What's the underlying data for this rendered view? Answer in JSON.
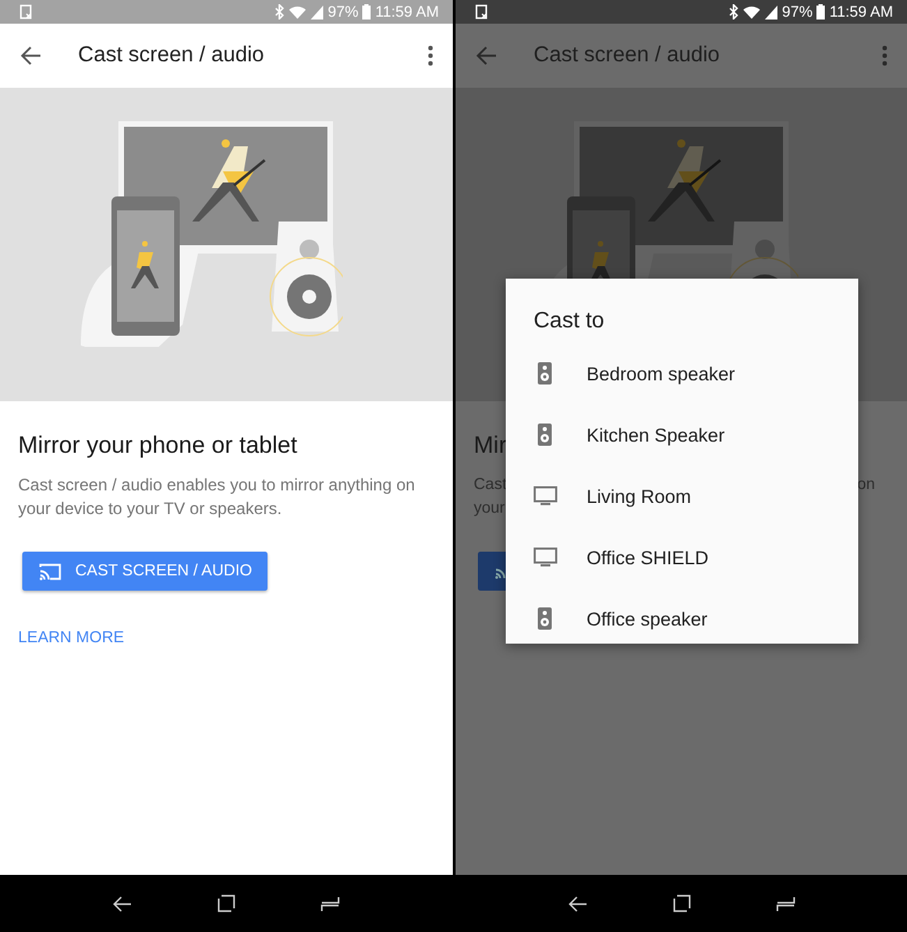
{
  "screens": [
    {
      "status_bar": {
        "battery": "97%",
        "time": "11:59 AM"
      },
      "app_bar": {
        "title": "Cast screen / audio"
      },
      "content": {
        "heading": "Mirror your phone or tablet",
        "description": "Cast screen / audio enables you to mirror anything on your device to your TV or speakers.",
        "button": "CAST SCREEN / AUDIO",
        "link": "LEARN MORE"
      }
    },
    {
      "status_bar": {
        "battery": "97%",
        "time": "11:59 AM"
      },
      "app_bar": {
        "title": "Cast screen / audio"
      },
      "covered_content": {
        "heading": "Mir",
        "line_1_start": "Cast",
        "line_1_end": "on",
        "line_2": "your"
      },
      "dialog": {
        "title": "Cast to",
        "devices": [
          {
            "name": "Bedroom speaker",
            "kind": "speaker"
          },
          {
            "name": "Kitchen Speaker",
            "kind": "speaker"
          },
          {
            "name": "Living Room",
            "kind": "tv"
          },
          {
            "name": "Office SHIELD",
            "kind": "tv"
          },
          {
            "name": "Office speaker",
            "kind": "speaker"
          }
        ]
      }
    }
  ]
}
